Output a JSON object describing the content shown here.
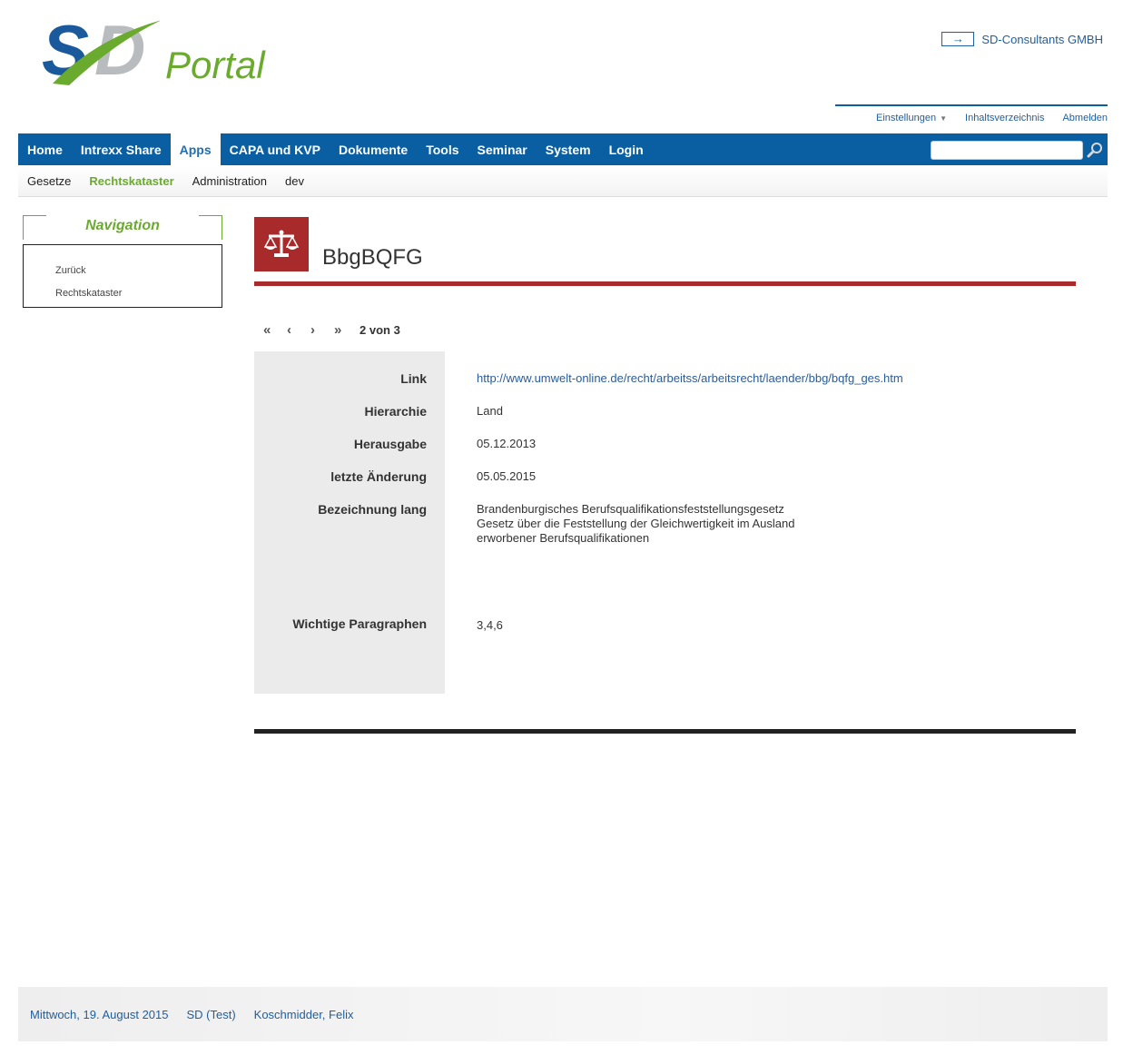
{
  "header": {
    "logo_text": "SD",
    "portal_label": "Portal",
    "company_link": "SD-Consultants GMBH",
    "util_links": [
      "Einstellungen",
      "Inhaltsverzeichnis",
      "Abmelden"
    ]
  },
  "mainnav": {
    "items": [
      "Home",
      "Intrexx Share",
      "Apps",
      "CAPA und KVP",
      "Dokumente",
      "Tools",
      "Seminar",
      "System",
      "Login"
    ],
    "active": "Apps",
    "search_placeholder": ""
  },
  "subnav": {
    "items": [
      "Gesetze",
      "Rechtskataster",
      "Administration",
      "dev"
    ],
    "active": "Rechtskataster"
  },
  "sidebar": {
    "title": "Navigation",
    "links": [
      "Zurück",
      "Rechtskataster"
    ]
  },
  "record": {
    "title": "BbgBQFG",
    "icon": "scales-icon",
    "pager": {
      "count_text": "2 von 3"
    },
    "fields": {
      "link_label": "Link",
      "link_value": "http://www.umwelt-online.de/recht/arbeitss/arbeitsrecht/laender/bbg/bqfg_ges.htm",
      "hierarchie_label": "Hierarchie",
      "hierarchie_value": "Land",
      "herausgabe_label": "Herausgabe",
      "herausgabe_value": "05.12.2013",
      "aenderung_label": "letzte Änderung",
      "aenderung_value": "05.05.2015",
      "bezeichnung_label": "Bezeichnung lang",
      "bezeichnung_lines": [
        "Brandenburgisches Berufsqualifikationsfeststellungsgesetz",
        "Gesetz über die Feststellung der Gleichwertigkeit im Ausland",
        "erworbener Berufsqualifikationen"
      ],
      "paragraphen_label": "Wichtige Paragraphen",
      "paragraphen_value": "3,4,6"
    }
  },
  "footer": {
    "date": "Mittwoch, 19. August 2015",
    "env": "SD (Test)",
    "user": "Koschmidder, Felix"
  },
  "colors": {
    "brand_blue": "#0a5fa3",
    "brand_green": "#6aab2f",
    "accent_red": "#a82a2a"
  }
}
